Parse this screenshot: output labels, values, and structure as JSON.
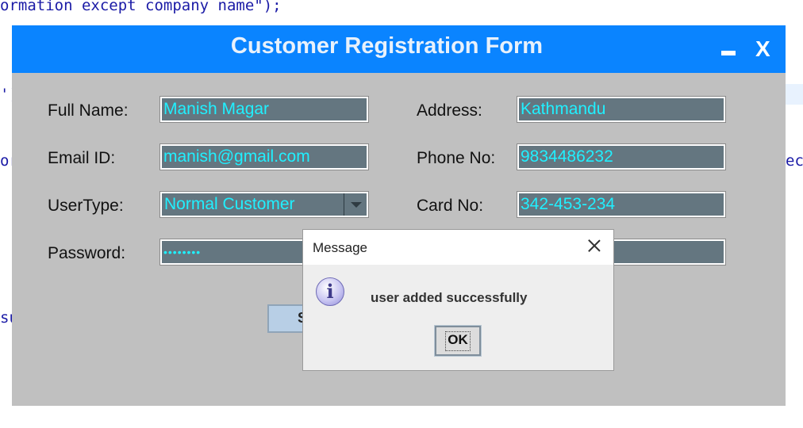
{
  "code": {
    "top_line": "ormation except company name\");",
    "frag_paren": "')",
    "frag_or": "or",
    "frag_su": "su",
    "frag_eci": "eci"
  },
  "window": {
    "title": "Customer Registration Form",
    "minimize_label": "",
    "close_label": "X"
  },
  "form": {
    "full_name_label": "Full Name:",
    "full_name_value": "Manish Magar",
    "email_label": "Email ID:",
    "email_value": "manish@gmail.com",
    "usertype_label": "UserType:",
    "usertype_value": "Normal Customer",
    "password_label": "Password:",
    "password_value": "••••••••",
    "address_label": "Address:",
    "address_value": "Kathmandu",
    "phone_label": "Phone No:",
    "phone_value": "9834486232",
    "card_label": "Card No:",
    "card_value": "342-453-234",
    "submit_label": "S"
  },
  "dialog": {
    "title": "Message",
    "message": "user added successfully",
    "icon_glyph": "i",
    "ok_label": "OK"
  },
  "colors": {
    "titlebar": "#0a84ff",
    "form_bg": "#c0c0c0",
    "field_bg": "#647680",
    "field_text": "#20f0ff"
  }
}
